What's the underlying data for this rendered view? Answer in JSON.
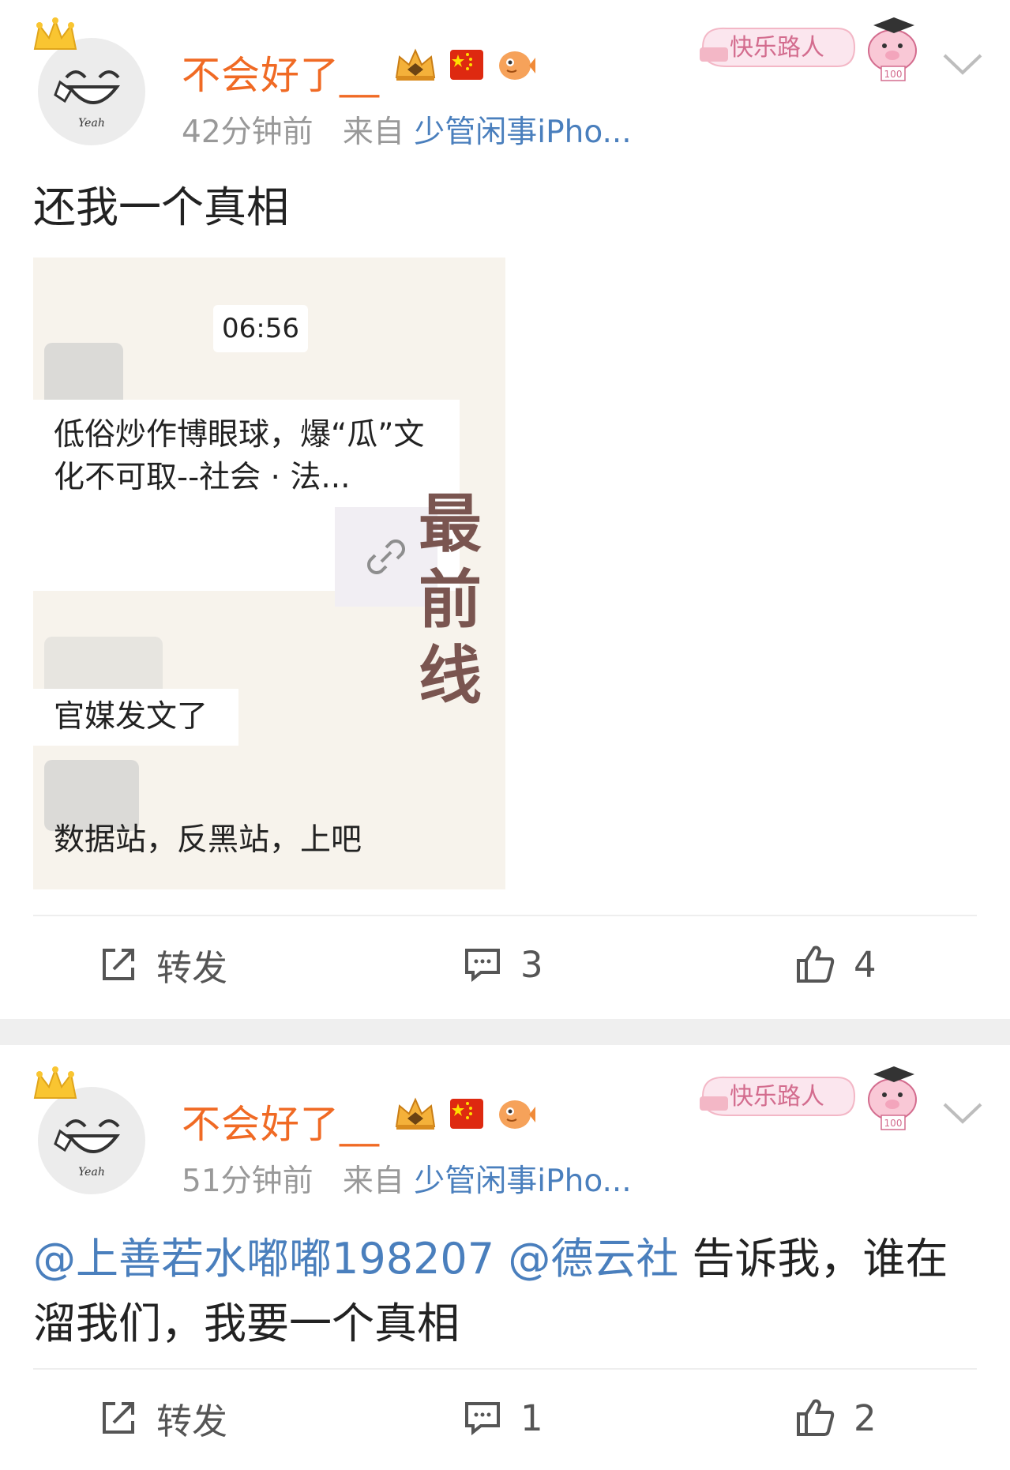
{
  "posts": [
    {
      "username": "不会好了__",
      "time": "42分钟前",
      "source_prefix": "来自",
      "source": "少管闲事iPho...",
      "badge_text": "快乐路人",
      "badge_number": "100",
      "avatar_label": "Yeah",
      "text": "还我一个真相",
      "thumbnail": {
        "time": "06:56",
        "card_text": "低俗炒作博眼球，爆“瓜”文化不可取--社会 · 法...",
        "line1": "官媒发文了",
        "line2": "数据站，反黑站，上吧",
        "vertical_text": "最前线"
      },
      "actions": {
        "repost_label": "转发",
        "comments": "3",
        "likes": "4"
      }
    },
    {
      "username": "不会好了__",
      "time": "51分钟前",
      "source_prefix": "来自",
      "source": "少管闲事iPho...",
      "badge_text": "快乐路人",
      "badge_number": "100",
      "avatar_label": "Yeah",
      "mention1": "@上善若水嘟嘟198207",
      "mention2": "@德云社",
      "text_rest": "告诉我，谁在溜我们，我要一个真相",
      "actions": {
        "repost_label": "转发",
        "comments": "1",
        "likes": "2"
      }
    }
  ],
  "icons": {
    "crown": "crown-icon",
    "vip_badge": "crown-badge-icon",
    "flag": "china-flag-icon",
    "fish": "fish-icon",
    "chevron": "chevron-down-icon",
    "repost": "share-icon",
    "comment": "comment-icon",
    "like": "thumbs-up-icon",
    "link": "link-icon"
  },
  "colors": {
    "username": "#f06a24",
    "link": "#4a7fbd",
    "meta": "#999999",
    "separator": "#efefef",
    "badge_pink": "#f3b7c6"
  }
}
